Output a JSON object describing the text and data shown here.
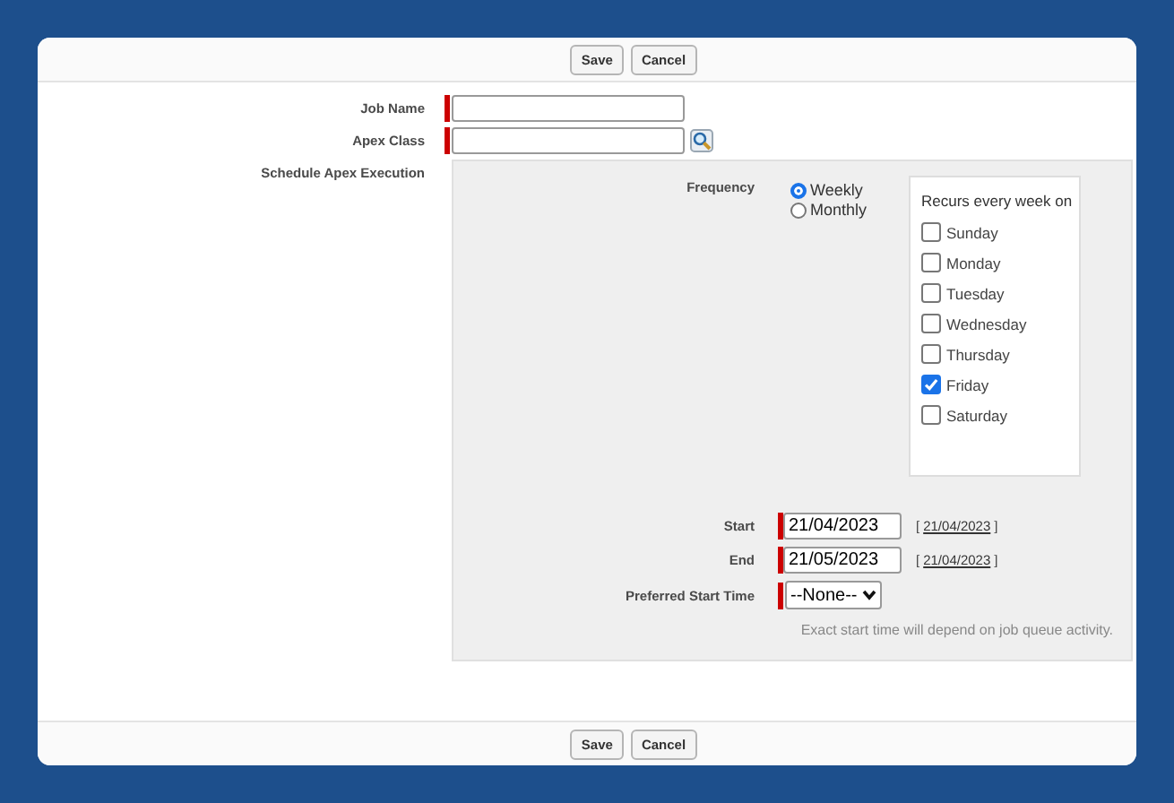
{
  "top_buttons": [
    "Save",
    "Cancel"
  ],
  "fields": [
    {
      "label": "Job Name",
      "lookup": false
    },
    {
      "label": "Apex Class",
      "lookup": true
    }
  ],
  "schedule": {
    "label": "Schedule Apex Execution",
    "frequency": {
      "label": "Frequency",
      "options": [
        {
          "label": "Weekly",
          "selected": true
        },
        {
          "label": "Monthly",
          "selected": false
        }
      ]
    },
    "recurs": {
      "title": "Recurs every week on",
      "days": [
        {
          "label": "Sunday",
          "checked": false
        },
        {
          "label": "Monday",
          "checked": false
        },
        {
          "label": "Tuesday",
          "checked": false
        },
        {
          "label": "Wednesday",
          "checked": false
        },
        {
          "label": "Thursday",
          "checked": false
        },
        {
          "label": "Friday",
          "checked": true
        },
        {
          "label": "Saturday",
          "checked": false
        }
      ]
    },
    "dates": [
      {
        "label": "Start",
        "value": "21/04/2023",
        "open": "[",
        "link": "21/04/2023",
        "close": "]"
      },
      {
        "label": "End",
        "value": "21/05/2023",
        "open": "[",
        "link": "21/04/2023",
        "close": "]"
      }
    ],
    "preferred_start_time": {
      "label": "Preferred Start Time",
      "value": "--None--"
    },
    "note": "Exact start time will depend on job queue activity."
  },
  "bottom_buttons": [
    "Save",
    "Cancel"
  ]
}
